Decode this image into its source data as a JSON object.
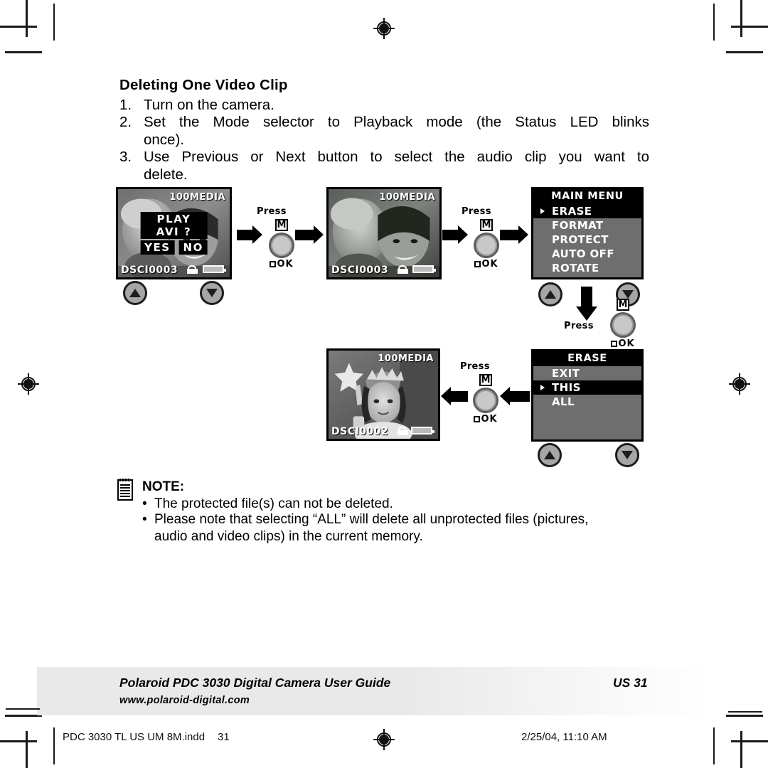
{
  "page": {
    "heading": "Deleting One Video Clip",
    "steps": [
      {
        "num": "1.",
        "text": "Turn on the camera."
      },
      {
        "num": "2.",
        "text": "Set the Mode selector to Playback mode (the Status LED blinks",
        "text2": "once)."
      },
      {
        "num": "3.",
        "text": "Use Previous or Next button to select the audio clip you want to",
        "text2": "delete."
      }
    ]
  },
  "screens": {
    "s1": {
      "media": "100MEDIA",
      "filename": "DSCI0003",
      "dialog_question": "PLAY AVI ?",
      "dialog_yes": "YES",
      "dialog_no": "NO"
    },
    "s2": {
      "media": "100MEDIA",
      "filename": "DSCI0003"
    },
    "s3": {
      "media": "100MEDIA",
      "filename": "DSCI0002"
    }
  },
  "menus": {
    "main": {
      "title": "MAIN MENU",
      "items": [
        {
          "label": "ERASE",
          "selected": true
        },
        {
          "label": "FORMAT",
          "selected": false
        },
        {
          "label": "PROTECT",
          "selected": false
        },
        {
          "label": "AUTO OFF",
          "selected": false
        },
        {
          "label": "ROTATE",
          "selected": false
        }
      ]
    },
    "erase": {
      "title": "ERASE",
      "items": [
        {
          "label": "EXIT",
          "selected": false
        },
        {
          "label": "THIS",
          "selected": true
        },
        {
          "label": "ALL",
          "selected": false
        }
      ]
    }
  },
  "controls": {
    "press_label": "Press",
    "m_label": "M",
    "ok_label": "OK"
  },
  "note": {
    "title": "NOTE:",
    "bullet": "•",
    "items": [
      {
        "line1": "The protected file(s) can not be deleted."
      },
      {
        "line1": "Please note that selecting “ALL” will delete all unprotected files (pictures,",
        "line2": "audio and video clips) in the current memory."
      }
    ]
  },
  "footer": {
    "title": "Polaroid PDC 3030 Digital Camera User Guide",
    "page": "US 31",
    "url": "www.polaroid-digital.com",
    "print_file": "PDC 3030 TL US UM 8M.indd",
    "print_page": "31",
    "print_date": "2/25/04, 11:10 AM"
  },
  "colors": {
    "menu_bg": "#6e6e6e",
    "menu_selected": "#000000",
    "footer_band": "#e9e9e9"
  }
}
